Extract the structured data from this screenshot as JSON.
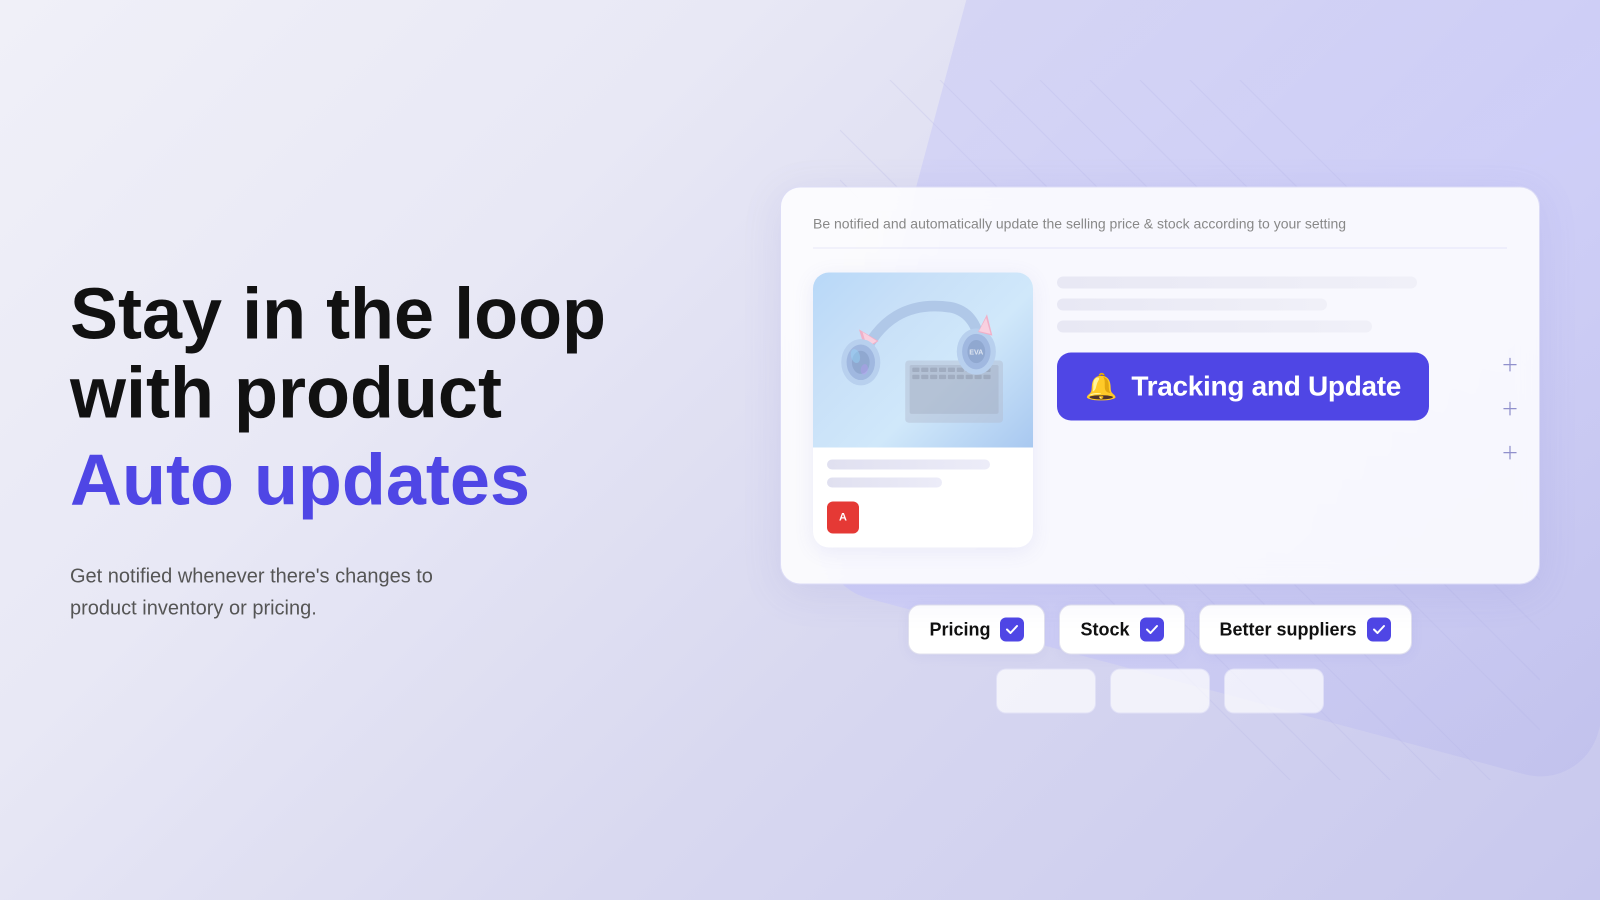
{
  "background": {
    "gradient_start": "#f0f0f8",
    "gradient_end": "#c8c8ee"
  },
  "left": {
    "headline_line1": "Stay in the loop",
    "headline_line2": "with product",
    "headline_accent": "Auto updates",
    "subtitle_line1": "Get notified whenever there's changes to",
    "subtitle_line2": "product inventory or pricing."
  },
  "card": {
    "subtitle": "Be notified and automatically update the selling price & stock according to your setting",
    "tracking_button_label": "Tracking and Update",
    "bell_icon": "🔔"
  },
  "tags": [
    {
      "label": "Pricing",
      "checked": true
    },
    {
      "label": "Stock",
      "checked": true
    },
    {
      "label": "Better suppliers",
      "checked": true
    }
  ],
  "product": {
    "aliexpress_badge": "A"
  }
}
